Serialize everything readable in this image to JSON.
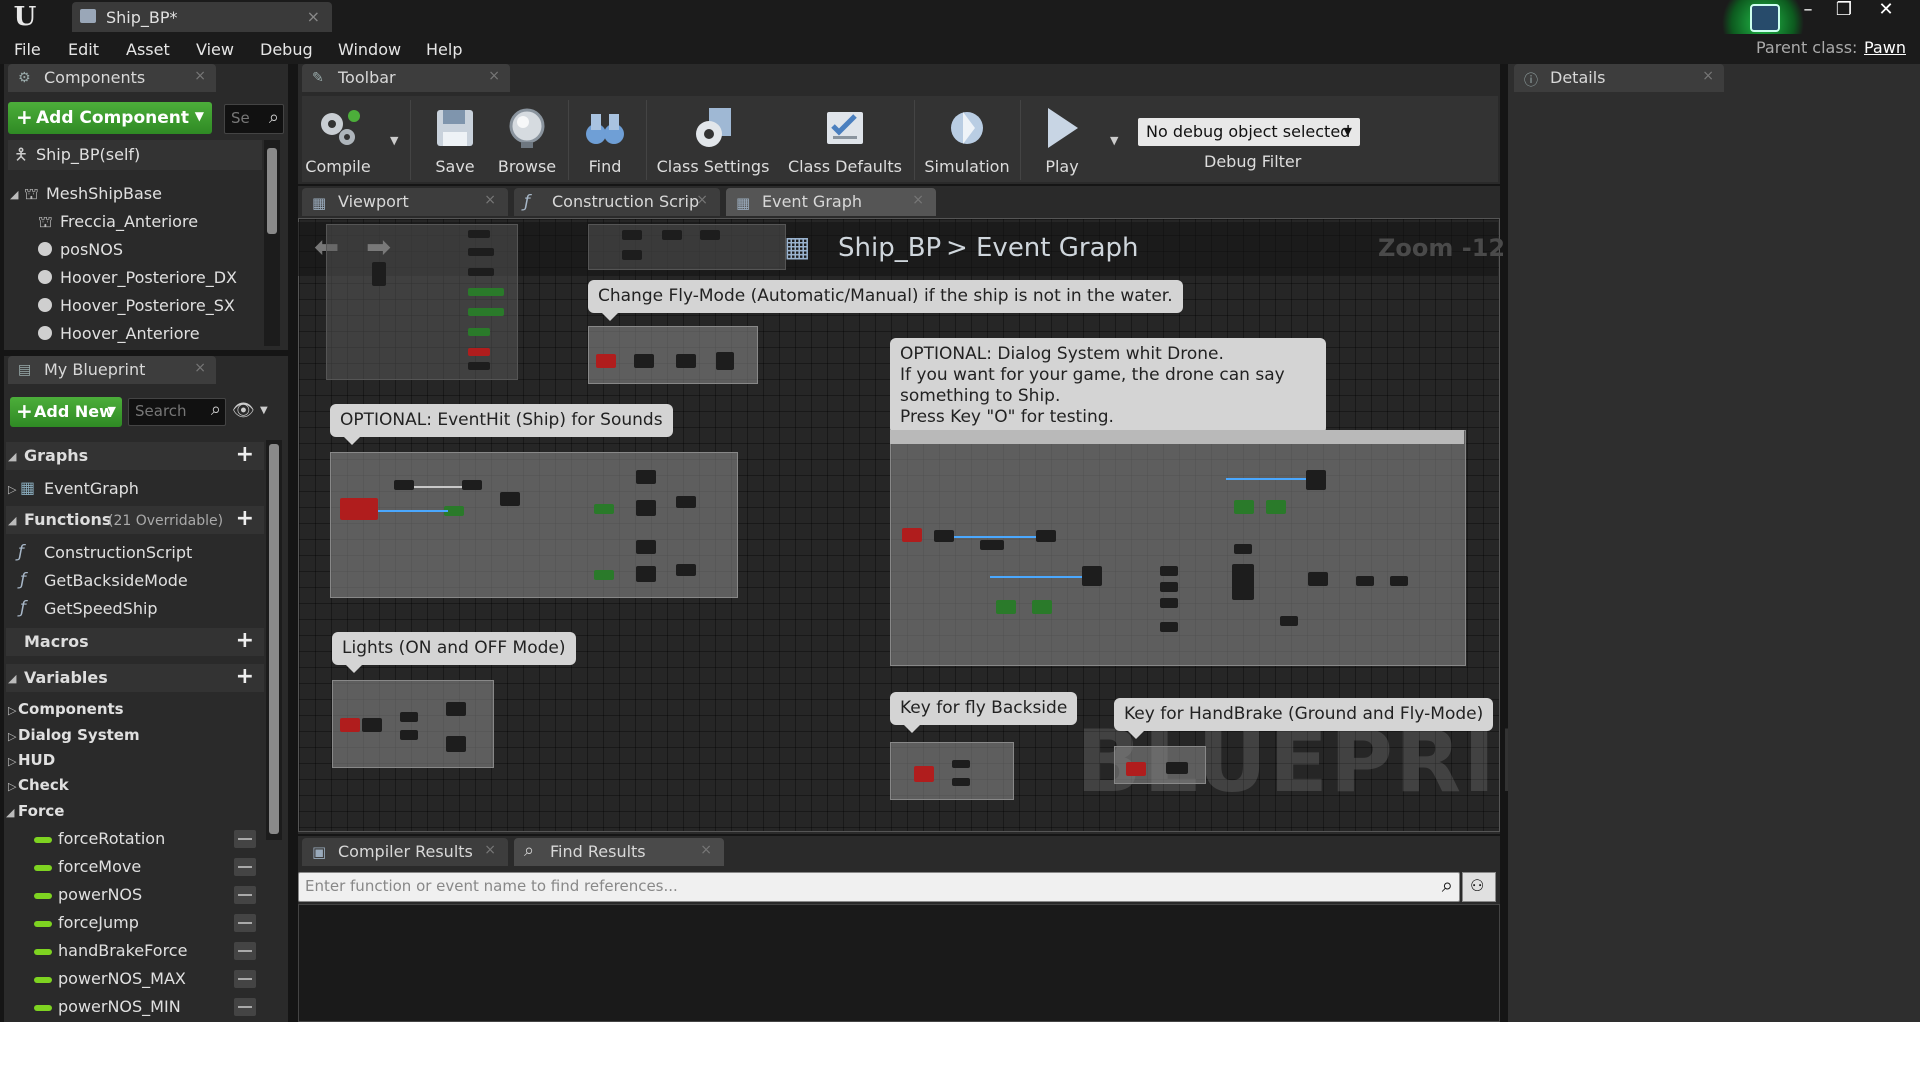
{
  "window": {
    "tab_title": "Ship_BP*",
    "parent_class_label": "Parent class:",
    "parent_class_value": "Pawn",
    "minimize_glyph": "–",
    "restore_glyph": "❐",
    "close_glyph": "✕"
  },
  "menu": {
    "items": [
      "File",
      "Edit",
      "Asset",
      "View",
      "Debug",
      "Window",
      "Help"
    ]
  },
  "components_panel": {
    "tab_label": "Components",
    "add_button": "Add Component",
    "search_placeholder": "Se",
    "self_item": "Ship_BP(self)",
    "root_item": "MeshShipBase",
    "children": [
      "Freccia_Anteriore",
      "posNOS",
      "Hoover_Posteriore_DX",
      "Hoover_Posteriore_SX",
      "Hoover_Anteriore"
    ]
  },
  "my_blueprint": {
    "tab_label": "My Blueprint",
    "add_new": "Add New",
    "search_placeholder": "Search",
    "graphs_label": "Graphs",
    "graphs": [
      "EventGraph"
    ],
    "functions_label": "Functions",
    "functions_count": "(21 Overridable)",
    "functions": [
      "ConstructionScript",
      "GetBacksideMode",
      "GetSpeedShip"
    ],
    "macros_label": "Macros",
    "variables_label": "Variables",
    "variable_groups": [
      "Components",
      "Dialog System",
      "HUD",
      "Check",
      "Force"
    ],
    "force_vars": [
      "forceRotation",
      "forceMove",
      "powerNOS",
      "forceJump",
      "handBrakeForce",
      "powerNOS_MAX",
      "powerNOS_MIN"
    ]
  },
  "toolbar": {
    "tab_label": "Toolbar",
    "compile": "Compile",
    "save": "Save",
    "browse": "Browse",
    "find": "Find",
    "class_settings": "Class Settings",
    "class_defaults": "Class Defaults",
    "simulation": "Simulation",
    "play": "Play",
    "debug_select": "No debug object selected",
    "debug_filter": "Debug Filter"
  },
  "graph_tabs": {
    "viewport": "Viewport",
    "construction": "Construction Scrip",
    "event_graph": "Event Graph"
  },
  "graph": {
    "crumb_root": "Ship_BP",
    "crumb_sep": ">",
    "crumb_current": "Event Graph",
    "zoom": "Zoom -12",
    "watermark": "BLUEPRINT",
    "comments": {
      "fly_mode": "Change Fly-Mode (Automatic/Manual) if the ship is not in the water.",
      "dialog_1": "OPTIONAL: Dialog System whit Drone.",
      "dialog_2": "If you want for your game, the drone can say something to Ship.",
      "dialog_3": "Press Key \"O\" for testing.",
      "event_hit": "OPTIONAL: EventHit (Ship) for Sounds",
      "lights": "Lights (ON and OFF Mode)",
      "backside": "Key for fly Backside",
      "handbrake": "Key for HandBrake (Ground and Fly-Mode)"
    }
  },
  "bottom": {
    "compiler_tab": "Compiler Results",
    "find_tab": "Find Results",
    "find_placeholder": "Enter function or event name to find references..."
  },
  "details": {
    "tab_label": "Details"
  },
  "colors": {
    "accent_green": "#4cae3a",
    "graph_bg": "#262626",
    "comment_bg": "#d4d4d4",
    "node_red": "#b01d1d",
    "var_green": "#7ed321"
  }
}
